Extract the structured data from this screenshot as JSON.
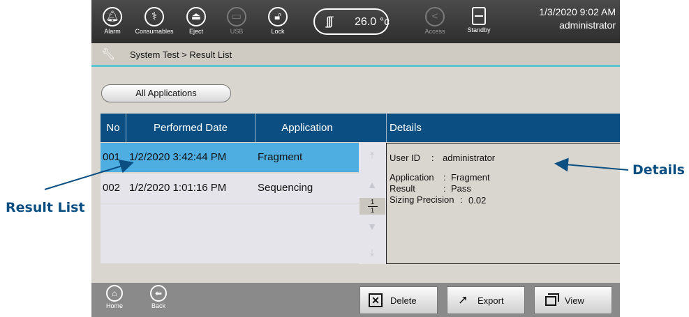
{
  "topbar": {
    "buttons": [
      {
        "label": "Alarm",
        "icon": "bell-icon"
      },
      {
        "label": "Consumables",
        "icon": "consumables-icon"
      },
      {
        "label": "Eject",
        "icon": "eject-icon"
      },
      {
        "label": "USB",
        "icon": "usb-icon"
      },
      {
        "label": "Lock",
        "icon": "lock-icon"
      },
      {
        "label": "Access",
        "icon": "share-icon"
      },
      {
        "label": "Standby",
        "icon": "standby-icon"
      }
    ],
    "temperature": "26.0 °c",
    "date_time": "1/3/2020 9:02 AM",
    "user": "administrator"
  },
  "breadcrumb": "System Test > Result List",
  "filter_button": "All Applications",
  "table": {
    "headers": [
      "No",
      "Performed Date",
      "Application"
    ],
    "rows": [
      {
        "no": "001",
        "date": "1/2/2020 3:42:44 PM",
        "application": "Fragment"
      },
      {
        "no": "002",
        "date": "1/2/2020 1:01:16 PM",
        "application": "Sequencing"
      }
    ],
    "pager_current": "1",
    "pager_total": "1"
  },
  "details": {
    "header": "Details",
    "fields": [
      {
        "label": "User ID",
        "sep": ":",
        "value": "administrator"
      },
      {
        "label": "Application",
        "sep": ":",
        "value": "Fragment"
      },
      {
        "label": "Result",
        "sep": ":",
        "value": "Pass"
      },
      {
        "label": "Sizing Precision",
        "sep": ":",
        "value": "0.02"
      }
    ]
  },
  "bottombar": {
    "home_label": "Home",
    "back_label": "Back",
    "delete_label": "Delete",
    "export_label": "Export",
    "view_label": "View"
  },
  "callouts": {
    "result_list": "Result List",
    "details": "Details"
  },
  "colors": {
    "header_blue": "#0b4f82",
    "selected_row": "#4eaee2",
    "accent_line": "#5cc4d3",
    "callout": "#0b4f82"
  }
}
